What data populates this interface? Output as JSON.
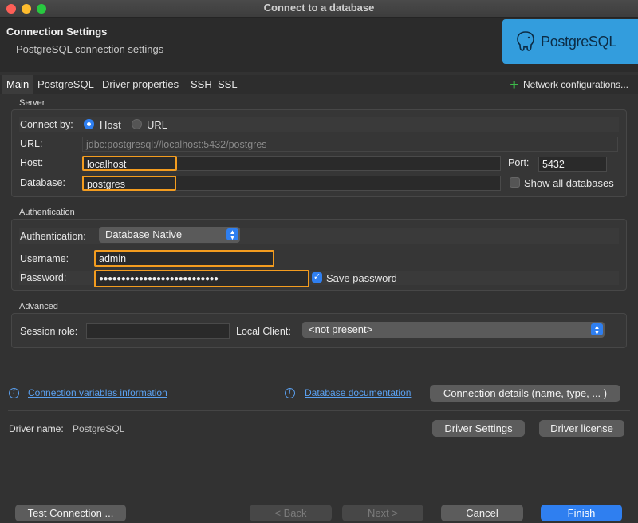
{
  "window": {
    "title": "Connect to a database"
  },
  "header": {
    "title": "Connection Settings",
    "subtitle": "PostgreSQL connection settings",
    "logo_text": "PostgreSQL"
  },
  "tabs": [
    {
      "label": "Main",
      "active": true
    },
    {
      "label": "PostgreSQL"
    },
    {
      "label": "Driver properties"
    },
    {
      "label": "SSH"
    },
    {
      "label": "SSL"
    }
  ],
  "network_config": {
    "label": "Network configurations..."
  },
  "server": {
    "group_label": "Server",
    "connect_by_label": "Connect by:",
    "options": [
      "Host",
      "URL"
    ],
    "selected": "Host",
    "url_label": "URL:",
    "url_value": "jdbc:postgresql://localhost:5432/postgres",
    "host_label": "Host:",
    "host_value": "localhost",
    "port_label": "Port:",
    "port_value": "5432",
    "database_label": "Database:",
    "database_value": "postgres",
    "show_all_label": "Show all databases"
  },
  "auth": {
    "group_label": "Authentication",
    "auth_label": "Authentication:",
    "auth_value": "Database Native",
    "username_label": "Username:",
    "username_value": "admin",
    "password_label": "Password:",
    "password_value": "●●●●●●●●●●●●●●●●●●●●●●●●●●●",
    "save_password_label": "Save password"
  },
  "advanced": {
    "group_label": "Advanced",
    "session_role_label": "Session role:",
    "session_role_value": "",
    "local_client_label": "Local Client:",
    "local_client_value": "<not present>"
  },
  "links": {
    "conn_vars": "Connection variables information",
    "db_docs": "Database documentation",
    "conn_details": "Connection details (name, type, ... )"
  },
  "driver": {
    "name_label": "Driver name:",
    "name_value": "PostgreSQL",
    "settings_btn": "Driver Settings",
    "license_btn": "Driver license"
  },
  "footer": {
    "test": "Test Connection ...",
    "back": "< Back",
    "next": "Next >",
    "cancel": "Cancel",
    "finish": "Finish"
  },
  "colors": {
    "accent": "#2f7ff0",
    "highlight": "#f39c1f",
    "logo_bg": "#339ddd"
  }
}
